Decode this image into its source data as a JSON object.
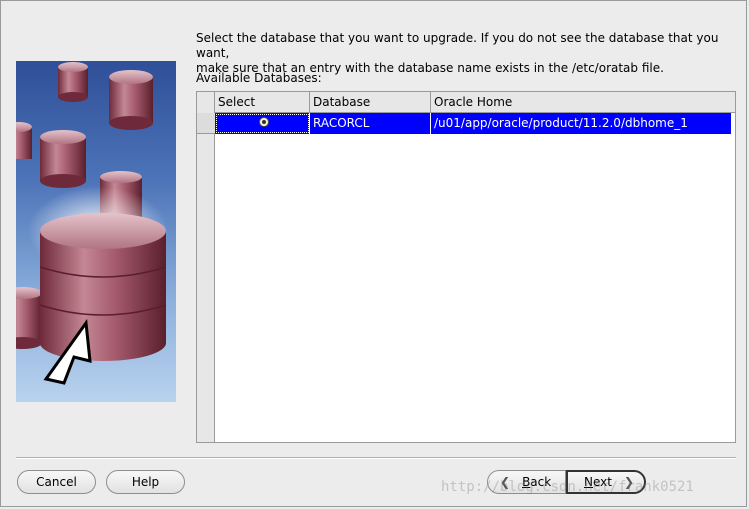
{
  "instructions": {
    "line1": "Select the database that you want to upgrade. If you do not see the database that you want,",
    "line2": "make sure that an entry with the database name exists in the /etc/oratab file."
  },
  "available_label": "Available Databases:",
  "table": {
    "columns": [
      "Select",
      "Database",
      "Oracle Home"
    ],
    "rows": [
      {
        "selected": true,
        "database": "RACORCL",
        "oracle_home": "/u01/app/oracle/product/11.2.0/dbhome_1"
      }
    ]
  },
  "buttons": {
    "cancel": "Cancel",
    "help": "Help",
    "back_prefix": "",
    "back_key": "B",
    "back_rest": "ack",
    "next_key": "N",
    "next_rest": "ext"
  },
  "watermark": "http://blog.csdn.net/frank0521",
  "colors": {
    "selection": "#0000ff",
    "background": "#ececec"
  },
  "icons": {
    "back": "chevron-left-icon",
    "next": "chevron-right-icon",
    "illustration": "database-cylinders-cursor-illustration"
  }
}
